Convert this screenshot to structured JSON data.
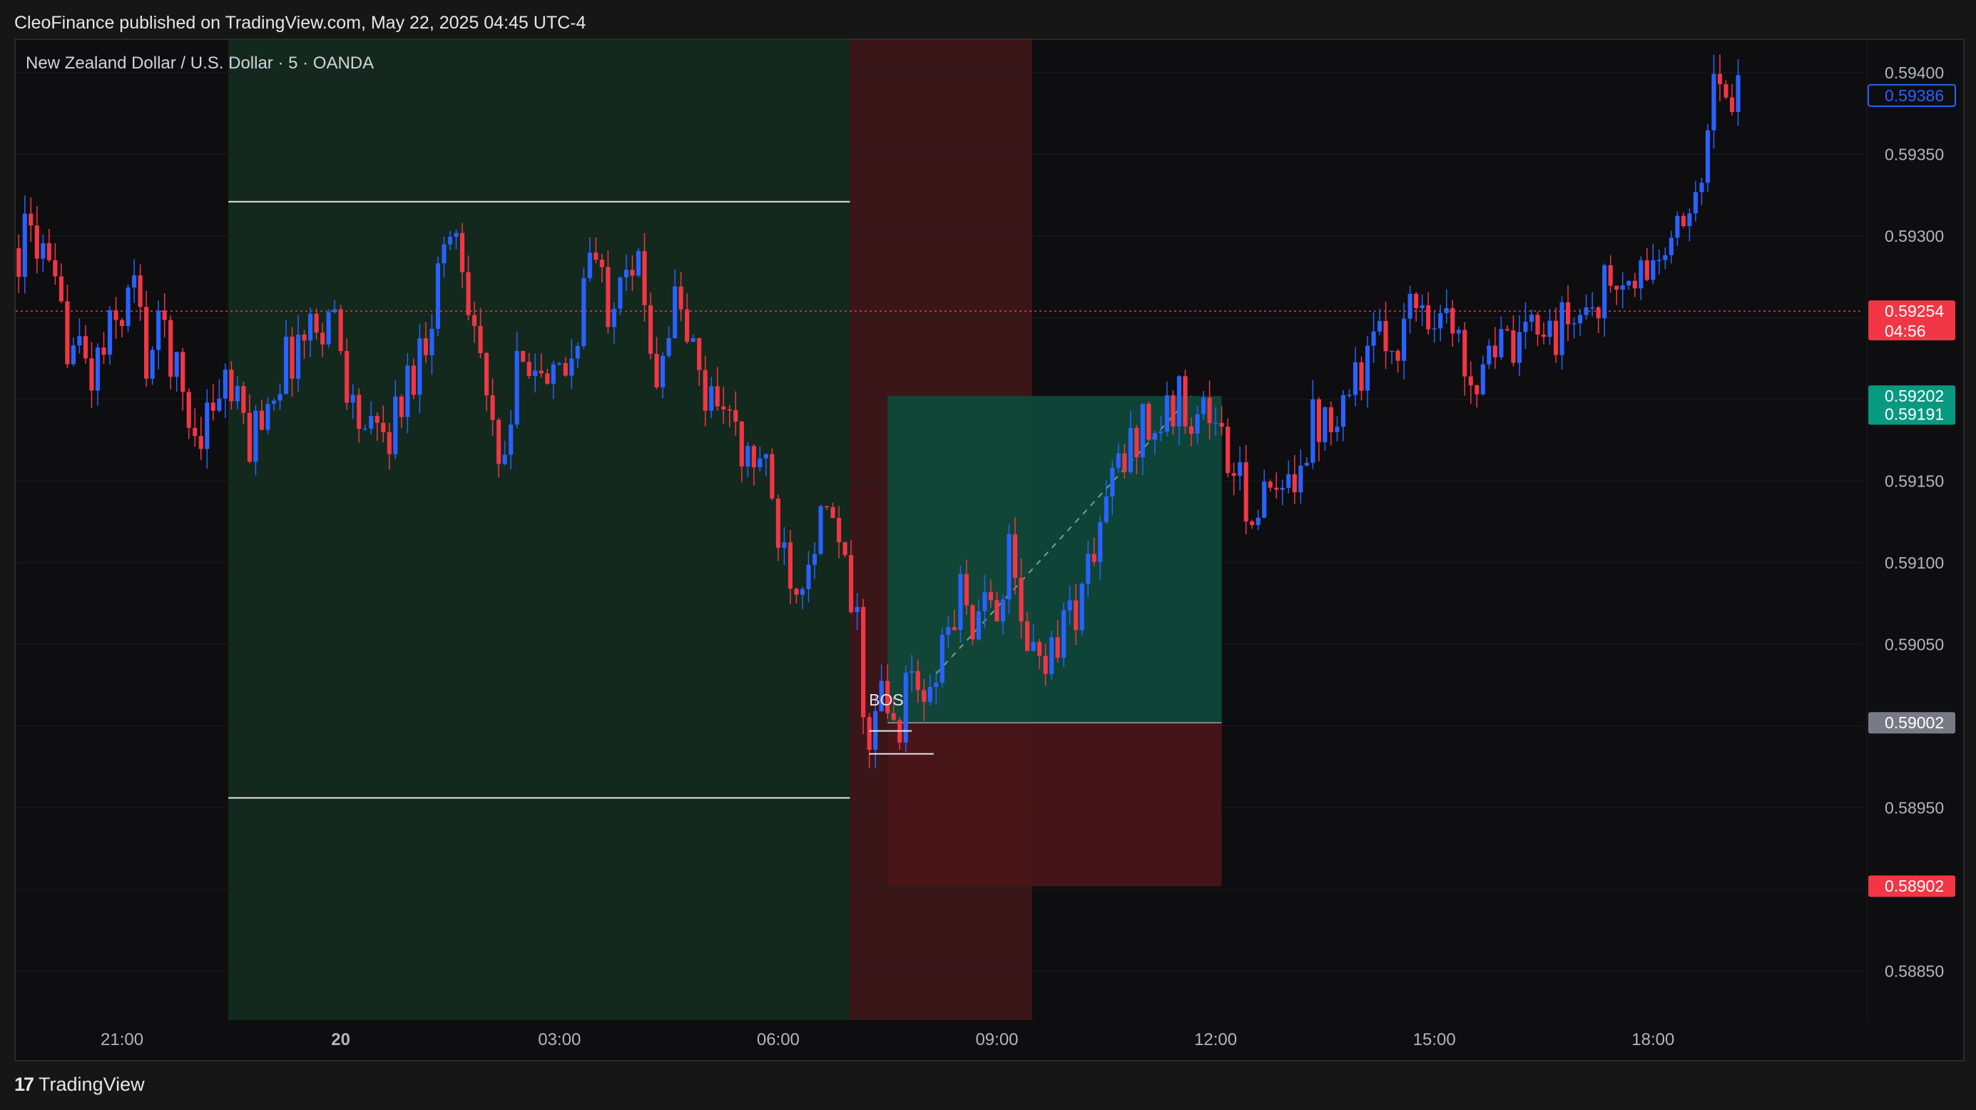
{
  "publish_info": "CleoFinance published on TradingView.com, May 22, 2025 04:45 UTC-4",
  "footer": {
    "logo": "TradingView",
    "logo_mark": "17"
  },
  "chart_data": {
    "type": "candlestick",
    "title": "New Zealand Dollar / U.S. Dollar · 5 · OANDA",
    "symbol": "NZDUSD",
    "timeframe": "5",
    "exchange": "OANDA",
    "colors": {
      "up": "#2962ff",
      "down": "#f23645",
      "background": "#0e0e10",
      "grid": "#1c1c20"
    },
    "x_ticks": [
      {
        "label": "21:00",
        "t": 0,
        "bold": false
      },
      {
        "label": "20",
        "t": 36,
        "bold": true
      },
      {
        "label": "03:00",
        "t": 72,
        "bold": false
      },
      {
        "label": "06:00",
        "t": 108,
        "bold": false
      },
      {
        "label": "09:00",
        "t": 144,
        "bold": false
      },
      {
        "label": "12:00",
        "t": 180,
        "bold": false
      },
      {
        "label": "15:00",
        "t": 216,
        "bold": false
      },
      {
        "label": "18:00",
        "t": 252,
        "bold": false
      }
    ],
    "price_axis": {
      "ylim": [
        0.5882,
        0.5942
      ],
      "ticks": [
        "0.59400",
        "0.59350",
        "0.59300",
        "0.59100",
        "0.59050",
        "0.58950",
        "0.58850",
        "0.59150"
      ]
    },
    "price_labels": [
      {
        "price": 0.59386,
        "text": "0.59386",
        "style": "outline",
        "color": "#2962ff"
      },
      {
        "price": 0.59254,
        "text": "0.59254",
        "sub": "04:56",
        "style": "filled",
        "color": "#f23645"
      },
      {
        "price": 0.59202,
        "text": "0.59202",
        "style": "filled",
        "color": "#089981"
      },
      {
        "price": 0.59191,
        "text": "0.59191",
        "style": "filled",
        "color": "#089981"
      },
      {
        "price": 0.59002,
        "text": "0.59002",
        "style": "filled",
        "color": "#787b86"
      },
      {
        "price": 0.58902,
        "text": "0.58902",
        "style": "filled",
        "color": "#f23645"
      }
    ],
    "current_price": 0.59254,
    "time_start": -17.5,
    "time_end": 286.6,
    "session_zones": [
      {
        "from": 17.5,
        "to": 119.8,
        "color": "#13291e"
      },
      {
        "from": 119.8,
        "to": 149.8,
        "color": "#3a1619"
      }
    ],
    "range_lines": [
      {
        "price": 0.59321,
        "from": 17.5,
        "to": 119.8
      },
      {
        "price": 0.58956,
        "from": 17.5,
        "to": 119.8
      }
    ],
    "bos": {
      "label": "BOS",
      "price": 0.59016,
      "t": 122
    },
    "structure_lines": [
      {
        "price": 0.58997,
        "from": 123,
        "to": 130
      },
      {
        "price": 0.58983,
        "from": 123,
        "to": 133.6
      }
    ],
    "position": {
      "from": 126,
      "to": 181,
      "entry": 0.59002,
      "target": 0.59202,
      "stop": 0.58902,
      "profit_color": "#0d4a3c",
      "loss_color": "#4a1519"
    },
    "series": [
      {
        "name": "NZD/USD",
        "anchors": [
          [
            -17.5,
            0.5929
          ],
          [
            -14.5,
            0.59305
          ],
          [
            -10,
            0.59245
          ],
          [
            -5,
            0.59215
          ],
          [
            0,
            0.59255
          ],
          [
            2,
            0.5927
          ],
          [
            4,
            0.59225
          ],
          [
            7,
            0.59245
          ],
          [
            10,
            0.592
          ],
          [
            12,
            0.5918
          ],
          [
            17,
            0.5921
          ],
          [
            21,
            0.59175
          ],
          [
            25,
            0.5921
          ],
          [
            29,
            0.59235
          ],
          [
            33,
            0.5925
          ],
          [
            35,
            0.5925
          ],
          [
            38,
            0.59195
          ],
          [
            41,
            0.59175
          ],
          [
            44,
            0.5918
          ],
          [
            47,
            0.5921
          ],
          [
            50,
            0.5924
          ],
          [
            53,
            0.59295
          ],
          [
            55,
            0.59305
          ],
          [
            58,
            0.5925
          ],
          [
            60,
            0.592
          ],
          [
            62,
            0.5915
          ],
          [
            64,
            0.59185
          ],
          [
            66,
            0.5924
          ],
          [
            70,
            0.592
          ],
          [
            74,
            0.59225
          ],
          [
            77,
            0.5929
          ],
          [
            80,
            0.5926
          ],
          [
            83,
            0.59295
          ],
          [
            85,
            0.59275
          ],
          [
            88,
            0.5922
          ],
          [
            91,
            0.5926
          ],
          [
            93,
            0.5924
          ],
          [
            96,
            0.592
          ],
          [
            99,
            0.59205
          ],
          [
            102,
            0.5916
          ],
          [
            105,
            0.59165
          ],
          [
            108,
            0.5912
          ],
          [
            111,
            0.5909
          ],
          [
            114,
            0.5912
          ],
          [
            117,
            0.59125
          ],
          [
            119,
            0.5909
          ],
          [
            121,
            0.5906
          ],
          [
            123,
            0.5898
          ],
          [
            125,
            0.5902
          ],
          [
            127,
            0.58995
          ],
          [
            130,
            0.5903
          ],
          [
            133,
            0.5901
          ],
          [
            135,
            0.5905
          ],
          [
            138,
            0.5908
          ],
          [
            141,
            0.5906
          ],
          [
            144,
            0.5908
          ],
          [
            146,
            0.591
          ],
          [
            148,
            0.59065
          ],
          [
            150,
            0.5904
          ],
          [
            153,
            0.5905
          ],
          [
            156,
            0.5907
          ],
          [
            158,
            0.5908
          ],
          [
            160,
            0.5911
          ],
          [
            163,
            0.5915
          ],
          [
            166,
            0.5917
          ],
          [
            168,
            0.5919
          ],
          [
            170,
            0.5918
          ],
          [
            173,
            0.59195
          ],
          [
            175,
            0.592
          ],
          [
            177,
            0.5919
          ],
          [
            179,
            0.59195
          ],
          [
            181,
            0.59175
          ],
          [
            183,
            0.5915
          ],
          [
            185,
            0.5914
          ],
          [
            187,
            0.5913
          ],
          [
            189,
            0.5914
          ],
          [
            191,
            0.59135
          ],
          [
            193,
            0.5916
          ],
          [
            196,
            0.59185
          ],
          [
            199,
            0.59195
          ],
          [
            202,
            0.5921
          ],
          [
            206,
            0.5923
          ],
          [
            210,
            0.5924
          ],
          [
            213,
            0.5926
          ],
          [
            217,
            0.59255
          ],
          [
            219,
            0.5924
          ],
          [
            221,
            0.59225
          ],
          [
            223,
            0.59215
          ],
          [
            225,
            0.5924
          ],
          [
            227,
            0.5923
          ],
          [
            230,
            0.59225
          ],
          [
            233,
            0.59255
          ],
          [
            236,
            0.5924
          ],
          [
            239,
            0.5925
          ],
          [
            242,
            0.5926
          ],
          [
            245,
            0.5927
          ],
          [
            248,
            0.59265
          ],
          [
            251,
            0.5928
          ],
          [
            254,
            0.5929
          ],
          [
            257,
            0.593
          ],
          [
            260,
            0.5935
          ],
          [
            262,
            0.59385
          ],
          [
            264,
            0.59395
          ],
          [
            266,
            0.59386
          ]
        ]
      }
    ]
  }
}
